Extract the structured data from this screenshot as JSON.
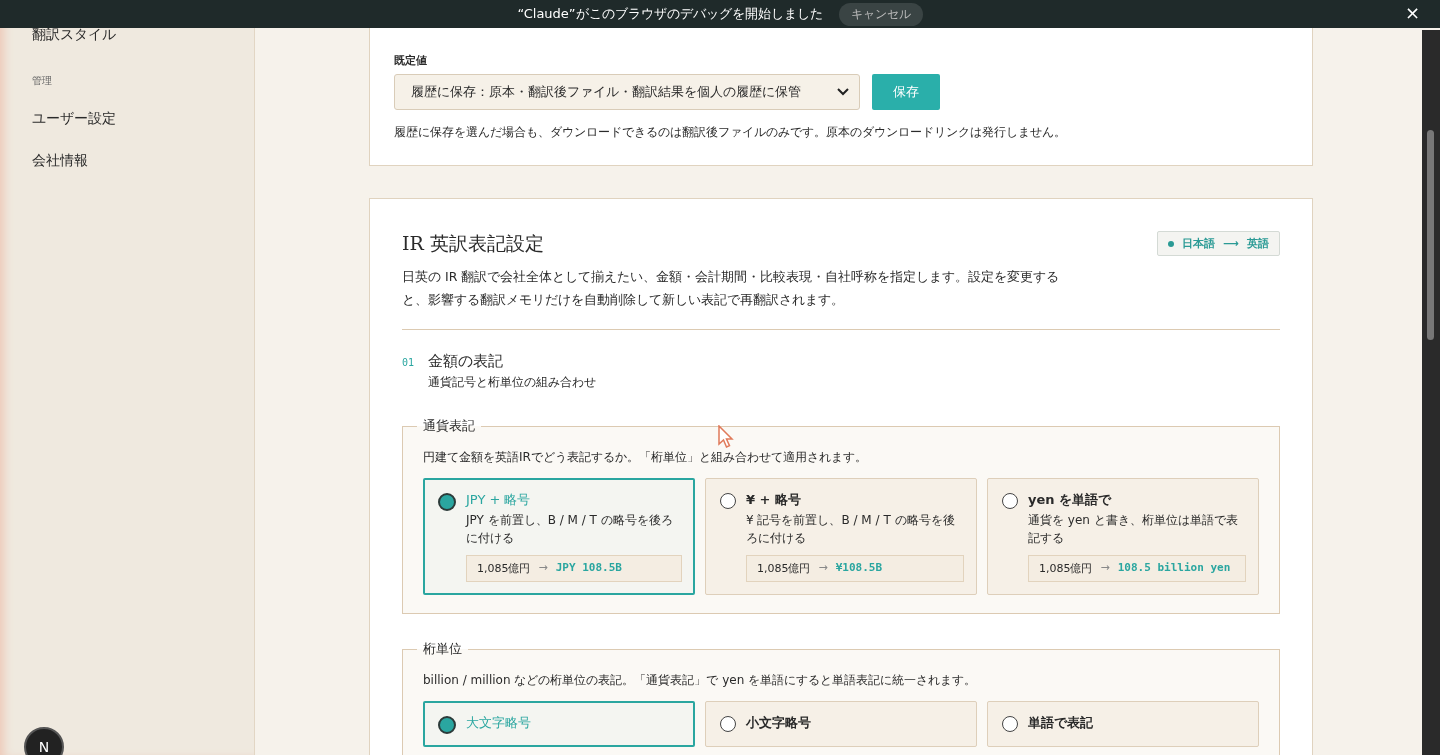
{
  "banner": {
    "message": "“Claude”がこのブラウザのデバッグを開始しました",
    "cancel": "キャンセル",
    "close": "×"
  },
  "sidebar": {
    "items": [
      {
        "kind": "item",
        "label": "翻訳スタイル"
      },
      {
        "kind": "heading",
        "label": "管理"
      },
      {
        "kind": "item",
        "label": "ユーザー設定"
      },
      {
        "kind": "item",
        "label": "会社情報"
      }
    ]
  },
  "history": {
    "label": "既定値",
    "value": "履歴に保存：原本・翻訳後ファイル・翻訳結果を個人の履歴に保管",
    "save": "保存",
    "note": "履歴に保存を選んだ場合も、ダウンロードできるのは翻訳後ファイルのみです。原本のダウンロードリンクは発行しません。"
  },
  "ir": {
    "title": "IR 英訳表記設定",
    "badge": {
      "from": "日本語",
      "arrow": "⟶",
      "to": "英語"
    },
    "description": "日英の IR 翻訳で会社全体として揃えたい、金額・会計期間・比較表現・自社呼称を指定します。設定を変更すると、影響する翻訳メモリだけを自動削除して新しい表記で再翻訳されます。",
    "sections": [
      {
        "number": "01",
        "title": "金額の表記",
        "subtitle": "通貨記号と桁単位の組み合わせ",
        "groups": [
          {
            "legend": "通貨表記",
            "hint": "円建て金額を英語IRでどう表記するか。「桁単位」と組み合わせて適用されます。",
            "options": [
              {
                "title": "JPY + 略号",
                "description": "JPY を前置し、B / M / T の略号を後ろに付ける",
                "example": {
                  "source": "1,085億円",
                  "arrow": "→",
                  "result": "JPY 108.5B"
                },
                "selected": true
              },
              {
                "title": "¥ + 略号",
                "description": "¥ 記号を前置し、B / M / T の略号を後ろに付ける",
                "example": {
                  "source": "1,085億円",
                  "arrow": "→",
                  "result": "¥108.5B"
                },
                "selected": false
              },
              {
                "title": "yen を単語で",
                "description": "通貨を yen と書き、桁単位は単語で表記する",
                "example": {
                  "source": "1,085億円",
                  "arrow": "→",
                  "result": "108.5 billion yen"
                },
                "selected": false
              }
            ]
          },
          {
            "legend": "桁単位",
            "hint": "billion / million などの桁単位の表記。「通貨表記」で yen を単語にすると単語表記に統一されます。",
            "options": [
              {
                "title": "大文字略号",
                "selected": true
              },
              {
                "title": "小文字略号",
                "selected": false
              },
              {
                "title": "単語で表記",
                "selected": false
              }
            ]
          }
        ]
      }
    ]
  },
  "dev_badge": "N"
}
